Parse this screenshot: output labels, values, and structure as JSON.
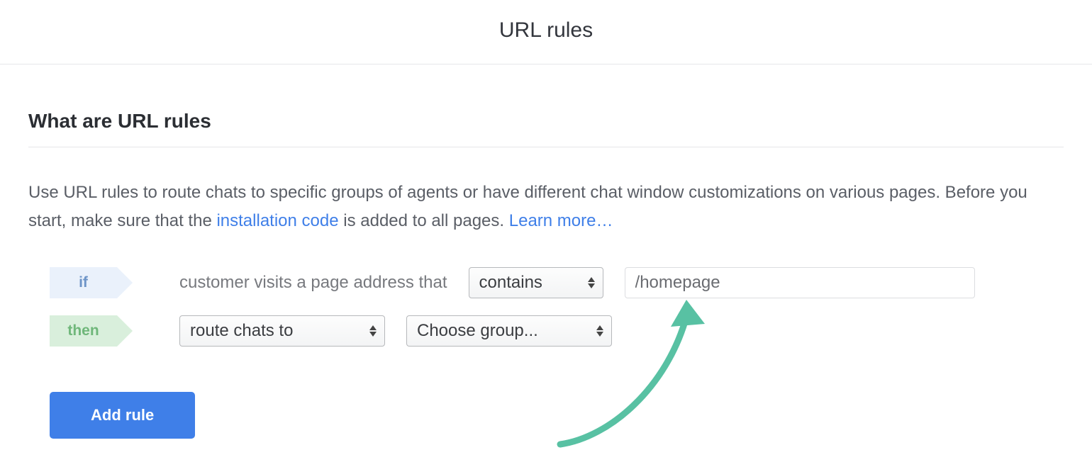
{
  "header": {
    "title": "URL rules"
  },
  "section": {
    "heading": "What are URL rules",
    "desc_pre": "Use URL rules to route chats to specific groups of agents or have different chat window customizations on various pages. Before you start, make sure that the ",
    "link_install": "installation code",
    "desc_mid": " is added to all pages. ",
    "link_learn": "Learn more…"
  },
  "rule": {
    "if_label": "if",
    "then_label": "then",
    "condition_text": "customer visits a page address that",
    "match_select": "contains",
    "path_value": "/homepage",
    "action_select": "route chats to",
    "group_select": "Choose group..."
  },
  "buttons": {
    "add_rule": "Add rule"
  }
}
